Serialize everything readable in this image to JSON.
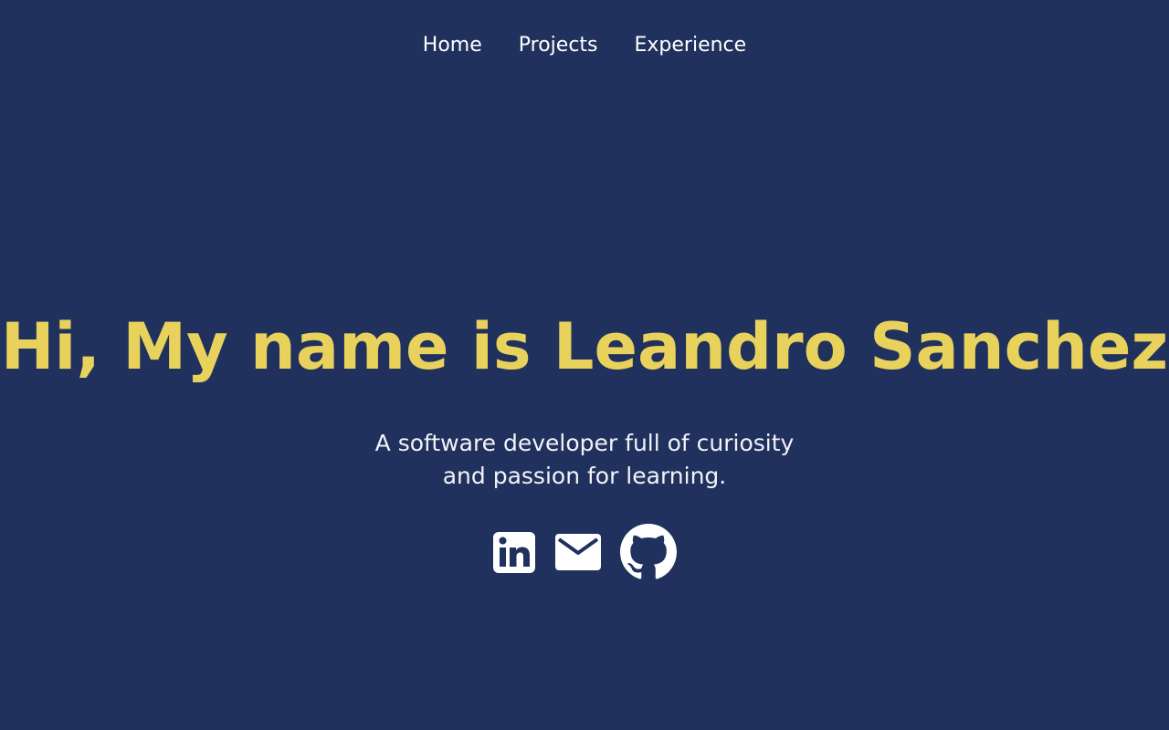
{
  "nav": {
    "items": [
      {
        "label": "Home"
      },
      {
        "label": "Projects"
      },
      {
        "label": "Experience"
      }
    ]
  },
  "hero": {
    "title": "Hi, My name is Leandro Sanchez",
    "subtitle_line1": "A software developer full of curiosity",
    "subtitle_line2": "and passion for learning."
  },
  "socials": [
    {
      "icon": "linkedin-icon"
    },
    {
      "icon": "mail-icon"
    },
    {
      "icon": "github-icon"
    }
  ],
  "colors": {
    "background": "#21315e",
    "accent": "#e8d25c",
    "text": "#ffffff"
  }
}
